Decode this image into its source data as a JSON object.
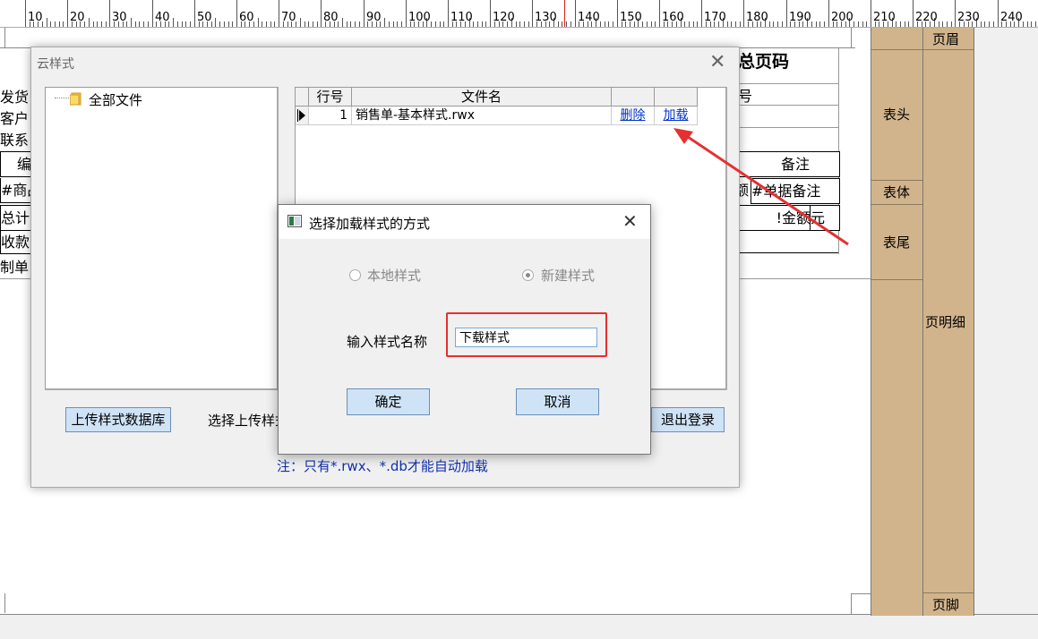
{
  "ruler": {
    "numbers": [
      "10",
      "20",
      "30",
      "40",
      "50",
      "60",
      "70",
      "80",
      "90",
      "100",
      "110",
      "120",
      "130",
      "140",
      "150",
      "160",
      "170",
      "180",
      "190",
      "200",
      "210",
      "220",
      "230",
      "240"
    ]
  },
  "report": {
    "title": "总页码",
    "header_number_label": "号",
    "fields": [
      "发货",
      "客户",
      "联系",
      "编",
      "#商品",
      "总计",
      "收款",
      "制单"
    ],
    "remarks_header": "备注",
    "col_header_partial": "额",
    "remarks_value": "#单据备注",
    "amount_partial": "!金额",
    "currency": "元"
  },
  "bands": {
    "page_header": "页眉",
    "header": "表头",
    "body": "表体",
    "footer": "表尾",
    "page_detail": "页明细",
    "page_footer": "页脚"
  },
  "cloud_window": {
    "title": "云样式",
    "tree_root": "全部文件",
    "grid": {
      "headers": [
        "行号",
        "文件名",
        "",
        ""
      ],
      "rows": [
        {
          "row_no": "1",
          "file_name": "销售单-基本样式.rwx",
          "delete_label": "删除",
          "load_label": "加载"
        }
      ]
    },
    "upload_button": "上传样式数据库",
    "select_upload_label": "选择上传样式",
    "logout_button": "退出登录",
    "note": "注：只有*.rwx、*.db才能自动加载"
  },
  "modal": {
    "title": "选择加载样式的方式",
    "option_local": "本地样式",
    "option_new": "新建样式",
    "selected_option": "新建样式",
    "name_label": "输入样式名称",
    "name_value": "下载样式",
    "ok_button": "确定",
    "cancel_button": "取消"
  },
  "colors": {
    "band": "#d2b48c",
    "button_bg": "#cfe3f7",
    "highlight": "#e53030",
    "link": "#0033cc"
  }
}
